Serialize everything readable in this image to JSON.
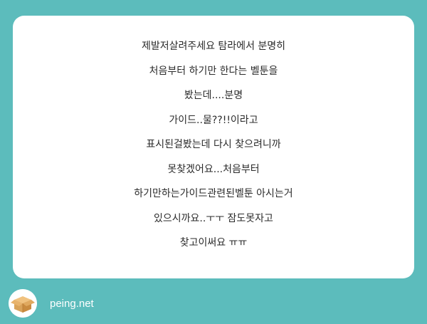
{
  "message": {
    "lines": [
      "제발저살려주세요 탐라에서 분명히",
      "처음부터 하기만 한다는 벨툰을",
      "봤는데....분명",
      "가이드..물??!!이라고",
      "표시된걸봤는데 다시 찾으려니까",
      "못찾겠어요...처음부터",
      "하기만하는가이드관련된벨툰 아시는거",
      "있으시까요..ㅜㅜ 잠도못자고",
      "찾고이써요 ㅠㅠ"
    ]
  },
  "footer": {
    "brand": "peing.net",
    "logo_icon": "box-icon"
  },
  "colors": {
    "background": "#5cbcbc",
    "card": "#ffffff",
    "text": "#2b2b2b",
    "box": "#d9a35a"
  }
}
